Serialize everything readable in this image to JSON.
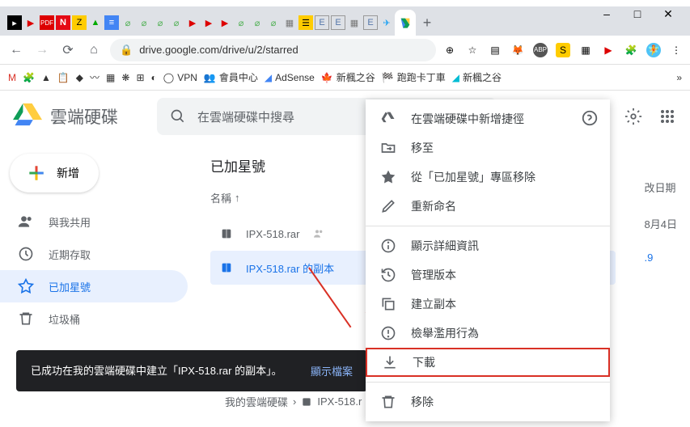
{
  "browser": {
    "url": "drive.google.com/drive/u/2/starred",
    "plus": "+",
    "window": {
      "min": "–",
      "max": "□",
      "close": "✕"
    }
  },
  "bookmarks": {
    "vpn": "VPN",
    "member": "會員中心",
    "adsense": "AdSense",
    "maple1": "新楓之谷",
    "kart": "跑跑卡丁車",
    "maple2": "新楓之谷",
    "more": "»"
  },
  "drive": {
    "title": "雲端硬碟",
    "search_placeholder": "在雲端硬碟中搜尋",
    "new_btn": "新增"
  },
  "sidebar": {
    "shared": "與我共用",
    "recent": "近期存取",
    "starred": "已加星號",
    "trash": "垃圾桶"
  },
  "content": {
    "title": "已加星號",
    "col_name": "名稱",
    "col_date_hdr": "改日期",
    "files": [
      {
        "name": "IPX-518.rar",
        "date": "8月4日"
      },
      {
        "name": "IPX-518.rar 的副本",
        "date": ".9"
      }
    ]
  },
  "context": {
    "shortcut": "在雲端硬碟中新增捷徑",
    "move": "移至",
    "unstar": "從「已加星號」專區移除",
    "rename": "重新命名",
    "details": "顯示詳細資訊",
    "versions": "管理版本",
    "copy": "建立副本",
    "report": "檢舉濫用行為",
    "download": "下載",
    "remove": "移除"
  },
  "toast": {
    "msg": "已成功在我的雲端硬碟中建立「IPX-518.rar 的副本」。",
    "action": "顯示檔案"
  },
  "breadcrumb": {
    "root": "我的雲端硬碟",
    "file": "IPX-518.r"
  }
}
